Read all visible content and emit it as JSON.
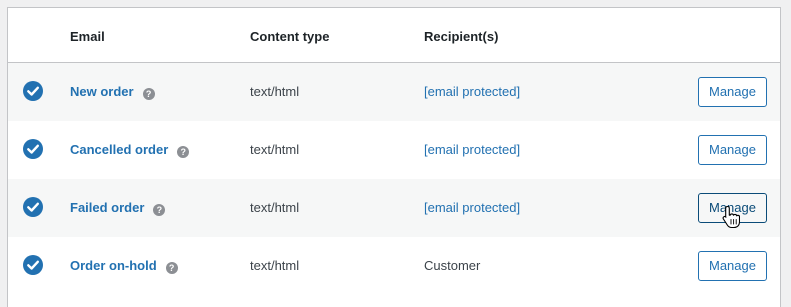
{
  "header": {
    "email": "Email",
    "content_type": "Content type",
    "recipients": "Recipient(s)"
  },
  "rows": [
    {
      "name": "New order",
      "content_type": "text/html",
      "recipient": "[email protected]",
      "recipient_is_link": true,
      "action": "Manage"
    },
    {
      "name": "Cancelled order",
      "content_type": "text/html",
      "recipient": "[email protected]",
      "recipient_is_link": true,
      "action": "Manage"
    },
    {
      "name": "Failed order",
      "content_type": "text/html",
      "recipient": "[email protected]",
      "recipient_is_link": true,
      "action": "Manage"
    },
    {
      "name": "Order on-hold",
      "content_type": "text/html",
      "recipient": "Customer",
      "recipient_is_link": false,
      "action": "Manage"
    }
  ],
  "help_glyph": "?",
  "colors": {
    "accent": "#2271b1",
    "text": "#1d2327",
    "muted": "#8c8f94",
    "row_alt": "#f6f7f7",
    "border": "#c3c4c7"
  },
  "icons": {
    "enabled": "check-circle-icon",
    "help": "help-icon",
    "cursor": "hand-pointer-cursor"
  }
}
